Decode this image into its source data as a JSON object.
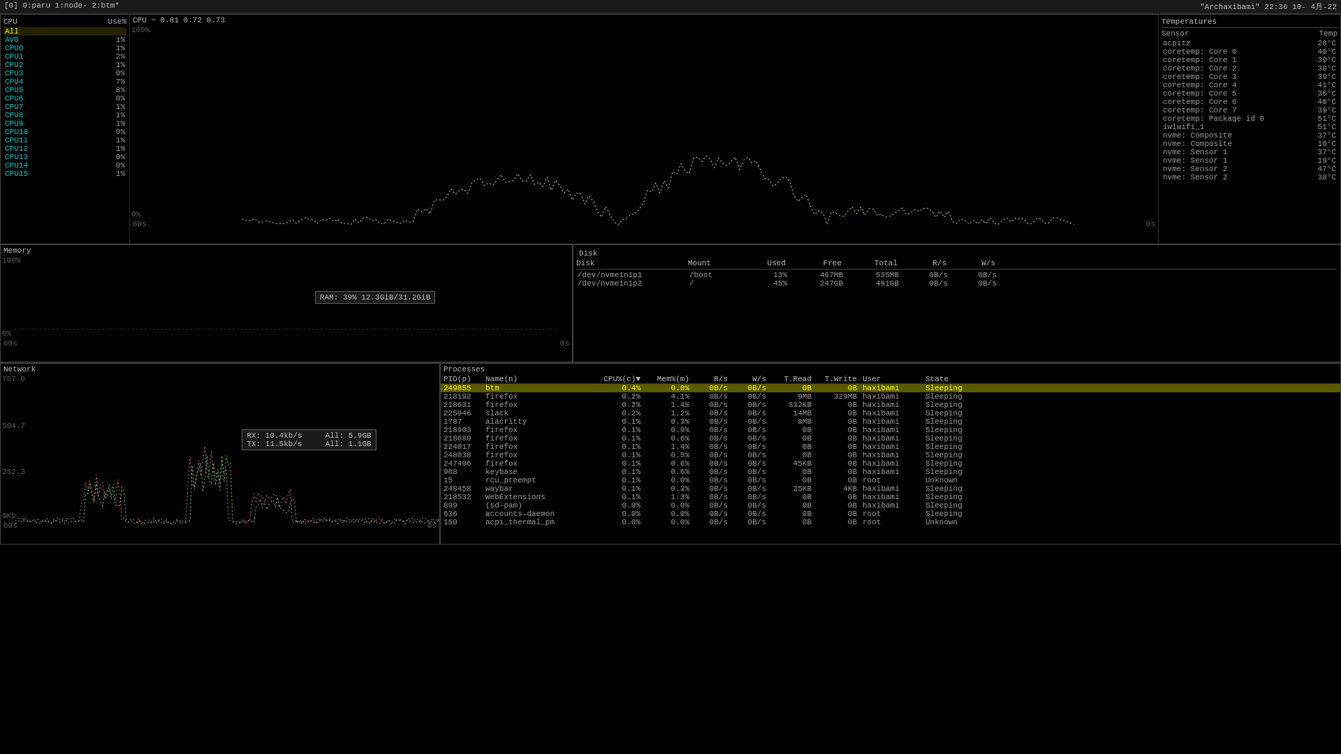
{
  "titlebar": {
    "tabs": "[0] 0:paru  1:node-  2:btm*",
    "datetime": "\"Archaxibami\" 22:36 10- 4月-22"
  },
  "cpu": {
    "header": {
      "col1": "CPU",
      "col2": "Use%"
    },
    "graph_title": "CPU − 0.81 0.72 0.73",
    "graph_label_100": "100%",
    "graph_label_0": "0%",
    "graph_time_left": "60s",
    "graph_time_right": "0s",
    "rows": [
      {
        "name": "All",
        "pct": "",
        "selected": true
      },
      {
        "name": "AVG",
        "pct": "1%"
      },
      {
        "name": "CPU0",
        "pct": "1%"
      },
      {
        "name": "CPU1",
        "pct": "2%"
      },
      {
        "name": "CPU2",
        "pct": "1%"
      },
      {
        "name": "CPU3",
        "pct": "0%"
      },
      {
        "name": "CPU4",
        "pct": "7%"
      },
      {
        "name": "CPU5",
        "pct": "8%"
      },
      {
        "name": "CPU6",
        "pct": "0%"
      },
      {
        "name": "CPU7",
        "pct": "1%"
      },
      {
        "name": "CPU8",
        "pct": "1%"
      },
      {
        "name": "CPU9",
        "pct": "1%"
      },
      {
        "name": "CPU10",
        "pct": "0%"
      },
      {
        "name": "CPU11",
        "pct": "1%"
      },
      {
        "name": "CPU12",
        "pct": "1%"
      },
      {
        "name": "CPU13",
        "pct": "0%"
      },
      {
        "name": "CPU14",
        "pct": "0%"
      },
      {
        "name": "CPU15",
        "pct": "1%"
      }
    ]
  },
  "temperatures": {
    "title": "Temperatures",
    "col_sensor": "Sensor",
    "col_temp": "Temp",
    "rows": [
      {
        "sensor": "acpitz",
        "temp": "28°C"
      },
      {
        "sensor": "coretemp: Core 0",
        "temp": "40°C"
      },
      {
        "sensor": "coretemp: Core 1",
        "temp": "39°C"
      },
      {
        "sensor": "coretemp: Core 2",
        "temp": "38°C"
      },
      {
        "sensor": "coretemp: Core 3",
        "temp": "39°C"
      },
      {
        "sensor": "coretemp: Core 4",
        "temp": "41°C"
      },
      {
        "sensor": "coretemp: Core 5",
        "temp": "36°C"
      },
      {
        "sensor": "coretemp: Core 6",
        "temp": "40°C"
      },
      {
        "sensor": "coretemp: Core 7",
        "temp": "39°C"
      },
      {
        "sensor": "coretemp: Package id 0",
        "temp": "51°C"
      },
      {
        "sensor": "iwlwifi_1",
        "temp": "51°C"
      },
      {
        "sensor": "nvme: Composite",
        "temp": "37°C"
      },
      {
        "sensor": "nvme: Composite",
        "temp": "19°C"
      },
      {
        "sensor": "nvme: Sensor 1",
        "temp": "37°C"
      },
      {
        "sensor": "nvme: Sensor 1",
        "temp": "19°C"
      },
      {
        "sensor": "nvme: Sensor 2",
        "temp": "47°C"
      },
      {
        "sensor": "nvme: Sensor 2",
        "temp": "38°C"
      }
    ]
  },
  "memory": {
    "title": "Memory",
    "graph_label_100": "100%",
    "graph_label_0": "0%",
    "graph_time_left": "60s",
    "graph_time_right": "0s",
    "tooltip": "RAM: 39%   12.3GiB/31.2GiB"
  },
  "disk": {
    "title": "Disk",
    "headers": [
      "Disk",
      "Mount",
      "Used",
      "Free",
      "Total",
      "R/s",
      "W/s"
    ],
    "rows": [
      {
        "disk": "/dev/nvme1n1p1",
        "mount": "/boot",
        "used": "13%",
        "free": "467MB",
        "total": "535MB",
        "rs": "0B/s",
        "ws": "0B/s"
      },
      {
        "disk": "/dev/nvme1n1p2",
        "mount": "/",
        "used": "45%",
        "free": "247GB",
        "total": "491GB",
        "rs": "0B/s",
        "ws": "0B/s"
      }
    ]
  },
  "network": {
    "title": "Network",
    "y_max": "757.0",
    "y_mid": "504.7",
    "y_low": "252.3",
    "y_min": "0Kb",
    "time_left": "60s",
    "time_right": "0s",
    "tooltip_rx": "RX: 10.4kb/s",
    "tooltip_rx_all": "All: 5.9GB",
    "tooltip_tx": "TX: 11.5kb/s",
    "tooltip_tx_all": "All: 1.1GB"
  },
  "processes": {
    "title": "Processes",
    "headers": {
      "pid": "PID(p)",
      "name": "Name(n)",
      "cpu": "CPU%(c)▼",
      "mem": "Mem%(m)",
      "rs": "R/s",
      "ws": "W/s",
      "tread": "T.Read",
      "twrite": "T.Write",
      "user": "User",
      "state": "State"
    },
    "rows": [
      {
        "pid": "249855",
        "name": "btm",
        "cpu": "0.4%",
        "mem": "0.0%",
        "rs": "0B/s",
        "ws": "0B/s",
        "tr": "0B",
        "tw": "0B",
        "user": "haxibami",
        "state": "Sleeping",
        "highlighted": true
      },
      {
        "pid": "218192",
        "name": "firefox",
        "cpu": "0.2%",
        "mem": "4.1%",
        "rs": "0B/s",
        "ws": "0B/s",
        "tr": "9MB",
        "tw": "329MB",
        "user": "haxibami",
        "state": "Sleeping"
      },
      {
        "pid": "218631",
        "name": "firefox",
        "cpu": "0.2%",
        "mem": "1.4%",
        "rs": "0B/s",
        "ws": "0B/s",
        "tr": "332KB",
        "tw": "0B",
        "user": "haxibami",
        "state": "Sleeping"
      },
      {
        "pid": "225946",
        "name": "slack",
        "cpu": "0.2%",
        "mem": "1.2%",
        "rs": "0B/s",
        "ws": "0B/s",
        "tr": "14MB",
        "tw": "0B",
        "user": "haxibami",
        "state": "Sleeping"
      },
      {
        "pid": "1787",
        "name": "alacritty",
        "cpu": "0.1%",
        "mem": "0.3%",
        "rs": "0B/s",
        "ws": "0B/s",
        "tr": "8MB",
        "tw": "0B",
        "user": "haxibami",
        "state": "Sleeping"
      },
      {
        "pid": "218903",
        "name": "firefox",
        "cpu": "0.1%",
        "mem": "0.9%",
        "rs": "0B/s",
        "ws": "0B/s",
        "tr": "0B",
        "tw": "0B",
        "user": "haxibami",
        "state": "Sleeping"
      },
      {
        "pid": "218680",
        "name": "firefox",
        "cpu": "0.1%",
        "mem": "0.6%",
        "rs": "0B/s",
        "ws": "0B/s",
        "tr": "0B",
        "tw": "0B",
        "user": "haxibami",
        "state": "Sleeping"
      },
      {
        "pid": "224017",
        "name": "firefox",
        "cpu": "0.1%",
        "mem": "1.4%",
        "rs": "0B/s",
        "ws": "0B/s",
        "tr": "0B",
        "tw": "0B",
        "user": "haxibami",
        "state": "Sleeping"
      },
      {
        "pid": "248038",
        "name": "firefox",
        "cpu": "0.1%",
        "mem": "0.5%",
        "rs": "0B/s",
        "ws": "0B/s",
        "tr": "0B",
        "tw": "0B",
        "user": "haxibami",
        "state": "Sleeping"
      },
      {
        "pid": "247496",
        "name": "firefox",
        "cpu": "0.1%",
        "mem": "0.6%",
        "rs": "0B/s",
        "ws": "0B/s",
        "tr": "45KB",
        "tw": "0B",
        "user": "haxibami",
        "state": "Sleeping"
      },
      {
        "pid": "908",
        "name": "keybase",
        "cpu": "0.1%",
        "mem": "0.6%",
        "rs": "0B/s",
        "ws": "0B/s",
        "tr": "0B",
        "tw": "0B",
        "user": "haxibami",
        "state": "Sleeping"
      },
      {
        "pid": "15",
        "name": "rcu_preempt",
        "cpu": "0.1%",
        "mem": "0.0%",
        "rs": "0B/s",
        "ws": "0B/s",
        "tr": "0B",
        "tw": "0B",
        "user": "root",
        "state": "Unknown"
      },
      {
        "pid": "248458",
        "name": "waybar",
        "cpu": "0.1%",
        "mem": "0.3%",
        "rs": "0B/s",
        "ws": "0B/s",
        "tr": "25KB",
        "tw": "4KB",
        "user": "haxibami",
        "state": "Sleeping"
      },
      {
        "pid": "218532",
        "name": "WebExtensions",
        "cpu": "0.1%",
        "mem": "1.3%",
        "rs": "0B/s",
        "ws": "0B/s",
        "tr": "0B",
        "tw": "0B",
        "user": "haxibami",
        "state": "Sleeping"
      },
      {
        "pid": "899",
        "name": "(sd-pam)",
        "cpu": "0.0%",
        "mem": "0.0%",
        "rs": "0B/s",
        "ws": "0B/s",
        "tr": "0B",
        "tw": "0B",
        "user": "haxibami",
        "state": "Sleeping"
      },
      {
        "pid": "636",
        "name": "accounts-daemon",
        "cpu": "0.0%",
        "mem": "0.0%",
        "rs": "0B/s",
        "ws": "0B/s",
        "tr": "0B",
        "tw": "0B",
        "user": "root",
        "state": "Sleeping"
      },
      {
        "pid": "150",
        "name": "acpi_thermal_pm",
        "cpu": "0.0%",
        "mem": "0.0%",
        "rs": "0B/s",
        "ws": "0B/s",
        "tr": "0B",
        "tw": "0B",
        "user": "root",
        "state": "Unknown"
      }
    ]
  }
}
